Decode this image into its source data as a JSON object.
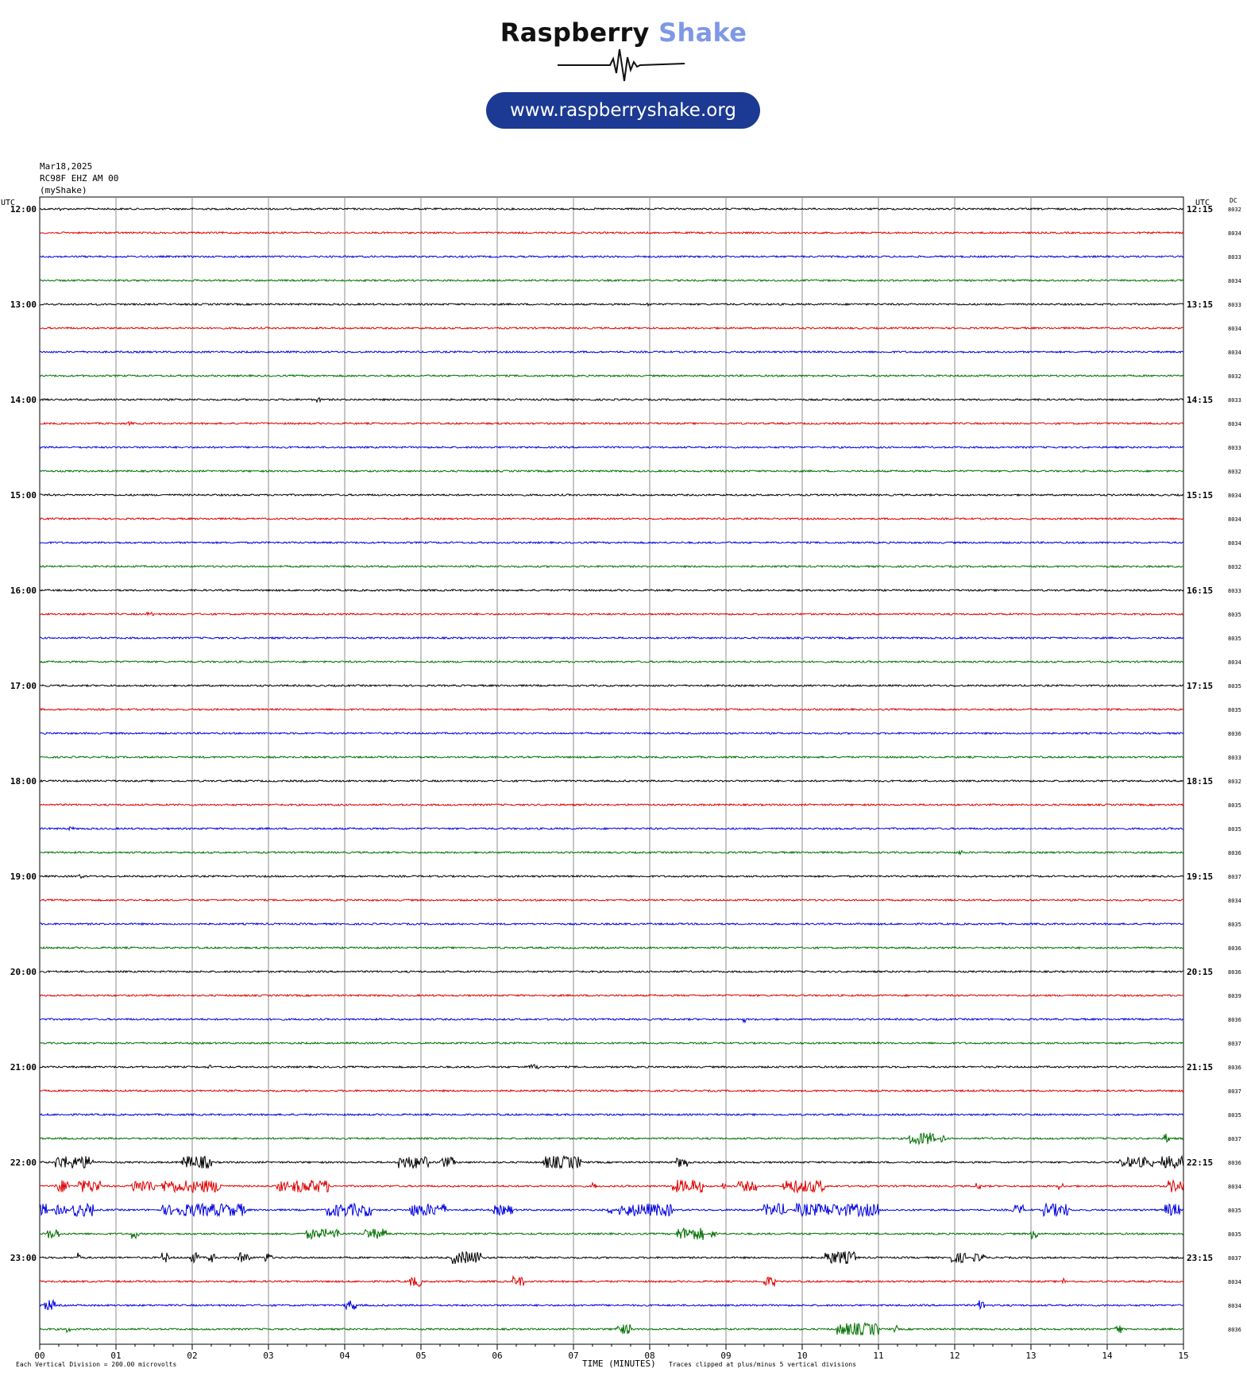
{
  "header": {
    "brand_part1": "Raspberry",
    "brand_part2": "Shake",
    "url": "www.raspberryshake.org",
    "brand_colors": {
      "dark": "#111111",
      "accent": "#7e98e6",
      "pill": "#1c3a94"
    }
  },
  "info": {
    "date": "Mar18,2025",
    "station": "RC98F EHZ AM 00",
    "network": "(myShake)"
  },
  "footer": {
    "scale_note": "Each Vertical Division =  200.00 microvolts",
    "x_title": "TIME (MINUTES)",
    "clip_note": "Traces clipped at plus/minus 5 vertical divisions"
  },
  "chart_data": {
    "type": "line",
    "title": "",
    "xlabel": "TIME (MINUTES)",
    "x_ticks": [
      "00",
      "01",
      "02",
      "03",
      "04",
      "05",
      "06",
      "07",
      "08",
      "09",
      "10",
      "11",
      "12",
      "13",
      "14",
      "15"
    ],
    "xlim": [
      0,
      15
    ],
    "left_axis_label": "UTC",
    "right_axis_label": "UTC",
    "dc_label": "DC",
    "grid": true,
    "trace_colors": [
      "#000000",
      "#e00000",
      "#0000e0",
      "#007000"
    ],
    "left_hour_labels": [
      "12:00",
      "13:00",
      "14:00",
      "15:00",
      "16:00",
      "17:00",
      "18:00",
      "19:00",
      "20:00",
      "21:00",
      "22:00",
      "23:00"
    ],
    "right_hour_labels": [
      "12:15",
      "13:15",
      "14:15",
      "15:15",
      "16:15",
      "17:15",
      "18:15",
      "19:15",
      "20:15",
      "21:15",
      "22:15",
      "23:15"
    ],
    "dc_values": [
      "8032",
      "8034",
      "8033",
      "8034",
      "8033",
      "8034",
      "8034",
      "8032",
      "8033",
      "8034",
      "8033",
      "8032",
      "8034",
      "8034",
      "8034",
      "8032",
      "8033",
      "8035",
      "8035",
      "8034",
      "8035",
      "8035",
      "8036",
      "8033",
      "8032",
      "8035",
      "8035",
      "8036",
      "8037",
      "8034",
      "8035",
      "8036",
      "8036",
      "8039",
      "8036",
      "8037",
      "8036",
      "8037",
      "8035",
      "8037",
      "8036",
      "8034",
      "8035",
      "8035",
      "8037",
      "8034",
      "8034",
      "8036"
    ],
    "events": [
      {
        "row": 0,
        "start": 0.24,
        "end": 0.28,
        "amp": 1.5
      },
      {
        "row": 4,
        "start": 7.95,
        "end": 8.02,
        "amp": 1.5
      },
      {
        "row": 8,
        "start": 3.62,
        "end": 3.68,
        "amp": 2
      },
      {
        "row": 9,
        "start": 1.15,
        "end": 1.2,
        "amp": 1.5
      },
      {
        "row": 17,
        "start": 1.4,
        "end": 1.5,
        "amp": 1.5
      },
      {
        "row": 26,
        "start": 0.38,
        "end": 0.44,
        "amp": 1.5
      },
      {
        "row": 27,
        "start": 12.05,
        "end": 12.1,
        "amp": 2
      },
      {
        "row": 28,
        "start": 0.5,
        "end": 0.58,
        "amp": 1.5
      },
      {
        "row": 33,
        "start": 7.3,
        "end": 7.36,
        "amp": 1.5
      },
      {
        "row": 34,
        "start": 9.22,
        "end": 9.26,
        "amp": 2.5
      },
      {
        "row": 36,
        "start": 2.2,
        "end": 2.24,
        "amp": 1.5
      },
      {
        "row": 36,
        "start": 6.4,
        "end": 6.55,
        "amp": 2
      },
      {
        "row": 39,
        "start": 11.4,
        "end": 11.75,
        "amp": 5
      },
      {
        "row": 39,
        "start": 11.82,
        "end": 11.88,
        "amp": 3
      },
      {
        "row": 39,
        "start": 14.75,
        "end": 14.82,
        "amp": 4
      },
      {
        "row": 40,
        "start": 0.2,
        "end": 0.7,
        "amp": 5
      },
      {
        "row": 40,
        "start": 1.85,
        "end": 2.25,
        "amp": 5
      },
      {
        "row": 40,
        "start": 4.7,
        "end": 5.1,
        "amp": 5
      },
      {
        "row": 40,
        "start": 5.25,
        "end": 5.45,
        "amp": 4
      },
      {
        "row": 40,
        "start": 6.6,
        "end": 7.1,
        "amp": 5
      },
      {
        "row": 40,
        "start": 8.35,
        "end": 8.5,
        "amp": 4
      },
      {
        "row": 40,
        "start": 14.15,
        "end": 14.4,
        "amp": 4
      },
      {
        "row": 40,
        "start": 14.4,
        "end": 14.6,
        "amp": 4
      },
      {
        "row": 40,
        "start": 14.7,
        "end": 15.0,
        "amp": 5
      },
      {
        "row": 41,
        "start": 0.2,
        "end": 0.4,
        "amp": 5
      },
      {
        "row": 41,
        "start": 0.5,
        "end": 0.8,
        "amp": 5
      },
      {
        "row": 41,
        "start": 1.2,
        "end": 1.5,
        "amp": 5
      },
      {
        "row": 41,
        "start": 1.6,
        "end": 1.95,
        "amp": 5
      },
      {
        "row": 41,
        "start": 2.0,
        "end": 2.4,
        "amp": 5
      },
      {
        "row": 41,
        "start": 3.1,
        "end": 3.25,
        "amp": 4
      },
      {
        "row": 41,
        "start": 3.3,
        "end": 3.8,
        "amp": 5
      },
      {
        "row": 41,
        "start": 7.25,
        "end": 7.3,
        "amp": 3
      },
      {
        "row": 41,
        "start": 8.3,
        "end": 8.7,
        "amp": 5
      },
      {
        "row": 41,
        "start": 8.95,
        "end": 9.0,
        "amp": 3
      },
      {
        "row": 41,
        "start": 9.15,
        "end": 9.4,
        "amp": 4
      },
      {
        "row": 41,
        "start": 9.75,
        "end": 10.3,
        "amp": 5
      },
      {
        "row": 41,
        "start": 12.28,
        "end": 12.35,
        "amp": 3
      },
      {
        "row": 41,
        "start": 13.35,
        "end": 13.42,
        "amp": 3
      },
      {
        "row": 41,
        "start": 14.8,
        "end": 15.0,
        "amp": 5
      },
      {
        "row": 42,
        "start": 0.0,
        "end": 0.1,
        "amp": 5
      },
      {
        "row": 42,
        "start": 0.2,
        "end": 0.35,
        "amp": 4
      },
      {
        "row": 42,
        "start": 0.4,
        "end": 0.7,
        "amp": 5
      },
      {
        "row": 42,
        "start": 1.6,
        "end": 1.75,
        "amp": 4
      },
      {
        "row": 42,
        "start": 1.8,
        "end": 2.7,
        "amp": 5
      },
      {
        "row": 42,
        "start": 3.75,
        "end": 4.35,
        "amp": 5
      },
      {
        "row": 42,
        "start": 4.85,
        "end": 5.35,
        "amp": 5
      },
      {
        "row": 42,
        "start": 5.95,
        "end": 6.2,
        "amp": 4
      },
      {
        "row": 42,
        "start": 7.45,
        "end": 7.5,
        "amp": 3
      },
      {
        "row": 42,
        "start": 7.6,
        "end": 8.3,
        "amp": 5
      },
      {
        "row": 42,
        "start": 9.5,
        "end": 9.8,
        "amp": 5
      },
      {
        "row": 42,
        "start": 9.9,
        "end": 11.0,
        "amp": 5
      },
      {
        "row": 42,
        "start": 12.75,
        "end": 12.9,
        "amp": 4
      },
      {
        "row": 42,
        "start": 13.15,
        "end": 13.5,
        "amp": 5
      },
      {
        "row": 42,
        "start": 14.75,
        "end": 14.95,
        "amp": 5
      },
      {
        "row": 43,
        "start": 0.1,
        "end": 0.25,
        "amp": 4
      },
      {
        "row": 43,
        "start": 1.2,
        "end": 1.3,
        "amp": 4
      },
      {
        "row": 43,
        "start": 3.5,
        "end": 3.75,
        "amp": 4
      },
      {
        "row": 43,
        "start": 3.8,
        "end": 3.95,
        "amp": 4
      },
      {
        "row": 43,
        "start": 4.25,
        "end": 4.55,
        "amp": 4
      },
      {
        "row": 43,
        "start": 8.35,
        "end": 8.7,
        "amp": 5
      },
      {
        "row": 43,
        "start": 8.8,
        "end": 8.88,
        "amp": 3
      },
      {
        "row": 43,
        "start": 13.0,
        "end": 13.1,
        "amp": 4
      },
      {
        "row": 44,
        "start": 0.5,
        "end": 0.55,
        "amp": 4
      },
      {
        "row": 44,
        "start": 1.6,
        "end": 1.7,
        "amp": 4
      },
      {
        "row": 44,
        "start": 1.95,
        "end": 2.1,
        "amp": 4
      },
      {
        "row": 44,
        "start": 2.2,
        "end": 2.3,
        "amp": 4
      },
      {
        "row": 44,
        "start": 2.6,
        "end": 2.75,
        "amp": 4
      },
      {
        "row": 44,
        "start": 2.95,
        "end": 3.05,
        "amp": 4
      },
      {
        "row": 44,
        "start": 5.4,
        "end": 5.8,
        "amp": 5
      },
      {
        "row": 44,
        "start": 10.3,
        "end": 10.7,
        "amp": 5
      },
      {
        "row": 44,
        "start": 11.95,
        "end": 12.15,
        "amp": 4
      },
      {
        "row": 44,
        "start": 12.25,
        "end": 12.4,
        "amp": 3
      },
      {
        "row": 45,
        "start": 4.85,
        "end": 5.0,
        "amp": 4
      },
      {
        "row": 45,
        "start": 6.2,
        "end": 6.35,
        "amp": 4
      },
      {
        "row": 45,
        "start": 9.5,
        "end": 9.65,
        "amp": 4
      },
      {
        "row": 45,
        "start": 13.4,
        "end": 13.45,
        "amp": 3
      },
      {
        "row": 46,
        "start": 0.05,
        "end": 0.2,
        "amp": 4
      },
      {
        "row": 46,
        "start": 4.0,
        "end": 4.15,
        "amp": 4
      },
      {
        "row": 46,
        "start": 12.3,
        "end": 12.4,
        "amp": 4
      },
      {
        "row": 47,
        "start": 0.35,
        "end": 0.4,
        "amp": 3
      },
      {
        "row": 47,
        "start": 7.55,
        "end": 7.75,
        "amp": 4
      },
      {
        "row": 47,
        "start": 10.45,
        "end": 11.0,
        "amp": 5
      },
      {
        "row": 47,
        "start": 11.2,
        "end": 11.25,
        "amp": 3
      },
      {
        "row": 47,
        "start": 14.1,
        "end": 14.2,
        "amp": 4
      }
    ]
  }
}
